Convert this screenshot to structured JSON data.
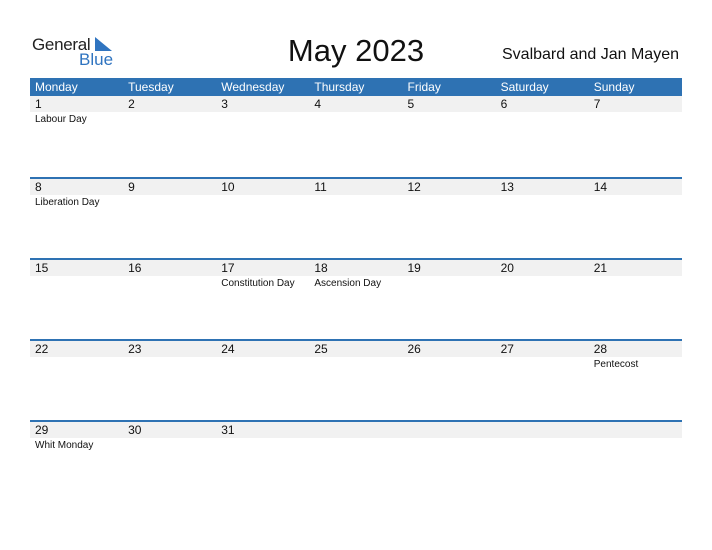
{
  "logo": {
    "line1": "General",
    "line2": "Blue",
    "accent_color": "#2f74c0"
  },
  "title": "May 2023",
  "region": "Svalbard and Jan Mayen",
  "header_color": "#2e72b3",
  "weekdays": [
    "Monday",
    "Tuesday",
    "Wednesday",
    "Thursday",
    "Friday",
    "Saturday",
    "Sunday"
  ],
  "weeks": [
    {
      "days": [
        "1",
        "2",
        "3",
        "4",
        "5",
        "6",
        "7"
      ],
      "events": [
        "Labour Day",
        "",
        "",
        "",
        "",
        "",
        ""
      ]
    },
    {
      "days": [
        "8",
        "9",
        "10",
        "11",
        "12",
        "13",
        "14"
      ],
      "events": [
        "Liberation Day",
        "",
        "",
        "",
        "",
        "",
        ""
      ]
    },
    {
      "days": [
        "15",
        "16",
        "17",
        "18",
        "19",
        "20",
        "21"
      ],
      "events": [
        "",
        "",
        "Constitution Day",
        "Ascension Day",
        "",
        "",
        ""
      ]
    },
    {
      "days": [
        "22",
        "23",
        "24",
        "25",
        "26",
        "27",
        "28"
      ],
      "events": [
        "",
        "",
        "",
        "",
        "",
        "",
        "Pentecost"
      ]
    },
    {
      "days": [
        "29",
        "30",
        "31",
        "",
        "",
        "",
        ""
      ],
      "events": [
        "Whit Monday",
        "",
        "",
        "",
        "",
        "",
        ""
      ]
    }
  ]
}
